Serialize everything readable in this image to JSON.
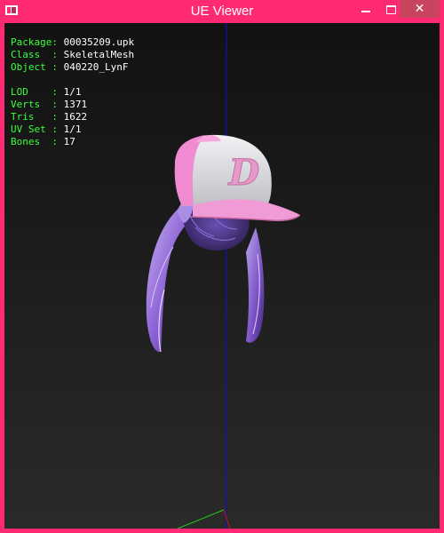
{
  "window": {
    "title": "UE Viewer",
    "close_glyph": "✕"
  },
  "colors": {
    "frame": "#ff2a73",
    "close": "#c7465d",
    "key_text": "#3cff3c",
    "value_text": "#ffffff"
  },
  "info": {
    "package": {
      "key": "Package:",
      "value": "00035209.upk"
    },
    "class": {
      "key": "Class  :",
      "value": "SkeletalMesh"
    },
    "object": {
      "key": "Object :",
      "value": "040220_LynF"
    },
    "lod": {
      "key": "LOD    :",
      "value": "1/1"
    },
    "verts": {
      "key": "Verts  :",
      "value": "1371"
    },
    "tris": {
      "key": "Tris   :",
      "value": "1622"
    },
    "uvset": {
      "key": "UV Set :",
      "value": "1/1"
    },
    "bones": {
      "key": "Bones  :",
      "value": "17"
    }
  },
  "model": {
    "cap_logo": "D"
  }
}
